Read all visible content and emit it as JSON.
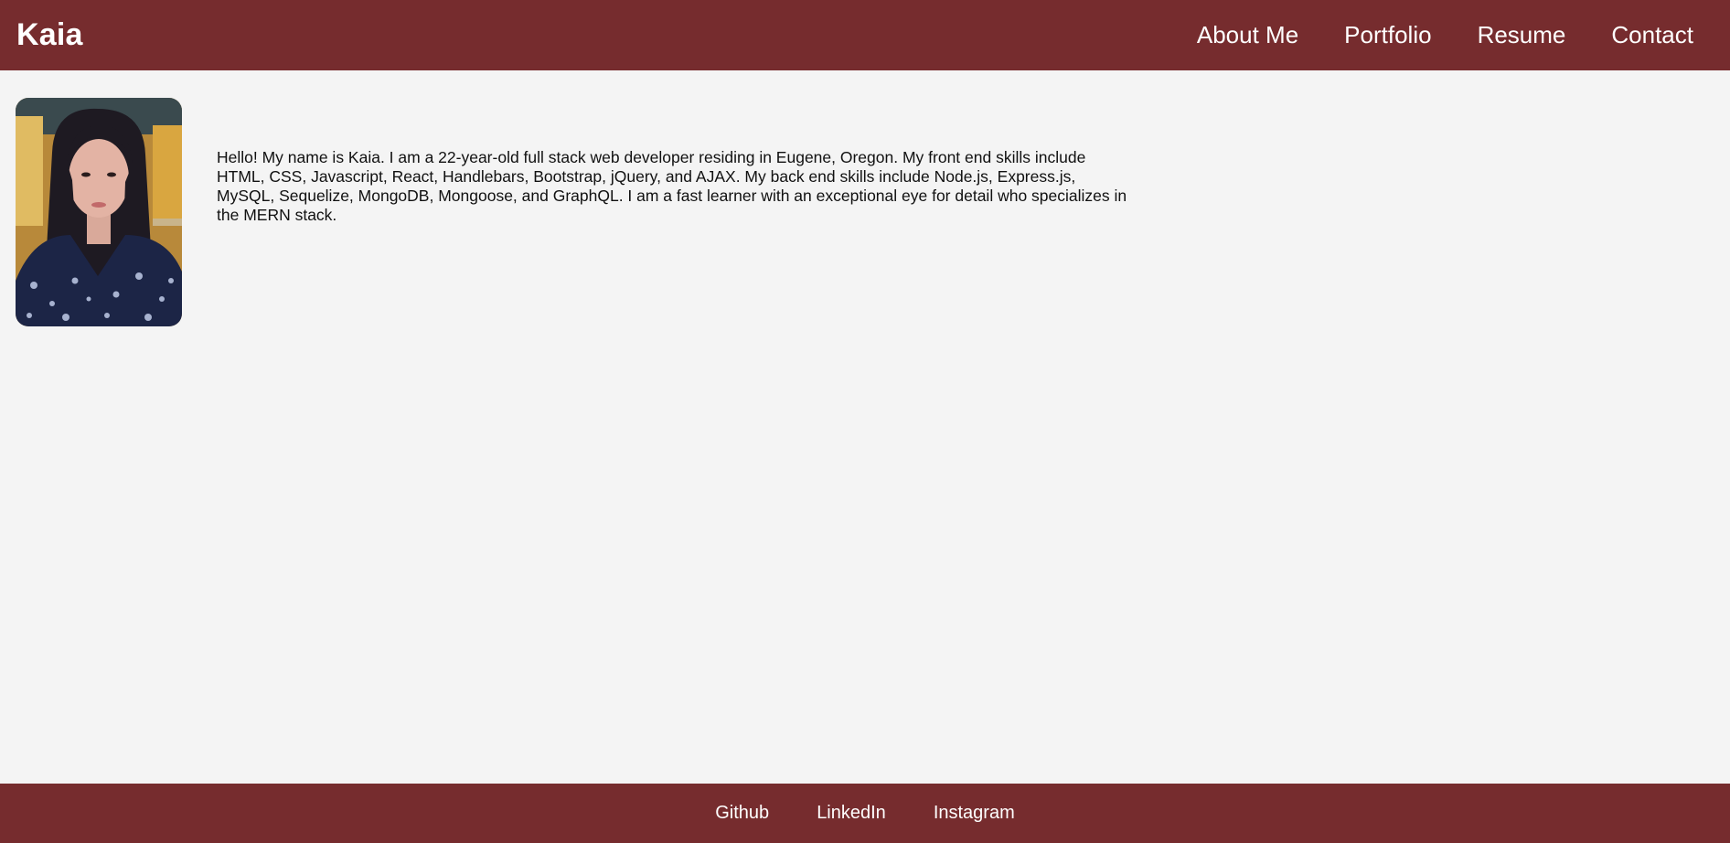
{
  "header": {
    "brand": "Kaia",
    "nav": [
      {
        "label": "About Me"
      },
      {
        "label": "Portfolio"
      },
      {
        "label": "Resume"
      },
      {
        "label": "Contact"
      }
    ]
  },
  "about": {
    "bio": "Hello! My name is Kaia. I am a 22-year-old full stack web developer residing in Eugene, Oregon. My front end skills include HTML, CSS, Javascript, React, Handlebars, Bootstrap, jQuery, and AJAX. My back end skills include Node.js, Express.js, MySQL, Sequelize, MongoDB, Mongoose, and GraphQL. I am a fast learner with an exceptional eye for detail who specializes in the MERN stack."
  },
  "footer": {
    "links": [
      {
        "label": "Github"
      },
      {
        "label": "LinkedIn"
      },
      {
        "label": "Instagram"
      }
    ]
  },
  "colors": {
    "brand_bar": "#762c2e",
    "page_background": "#f4f4f4",
    "text": "#111111",
    "nav_text": "#ffffff"
  }
}
